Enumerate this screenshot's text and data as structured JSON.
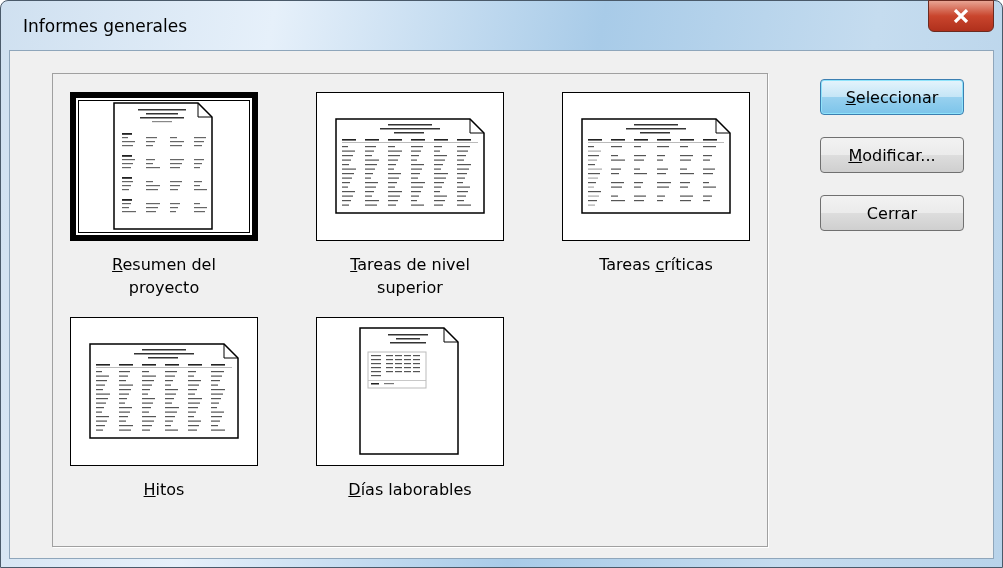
{
  "window": {
    "title": "Informes generales"
  },
  "reports": [
    {
      "access_key": "R",
      "text_after": "esumen del proyecto",
      "kind": "summary",
      "selected": true
    },
    {
      "access_key": "T",
      "text_after": "areas de nivel superior",
      "kind": "table",
      "selected": false
    },
    {
      "text_before": "Tareas ",
      "access_key": "c",
      "text_after": "ríticas",
      "kind": "critical",
      "selected": false
    },
    {
      "access_key": "H",
      "text_after": "itos",
      "kind": "table",
      "selected": false
    },
    {
      "access_key": "D",
      "text_after": "ías laborables",
      "kind": "calendar",
      "selected": false
    }
  ],
  "buttons": [
    {
      "access_key": "S",
      "text_after": "eleccionar",
      "default": true
    },
    {
      "access_key": "M",
      "text_after": "odificar...",
      "default": false
    },
    {
      "text_before": "Cerrar",
      "default": false
    }
  ]
}
